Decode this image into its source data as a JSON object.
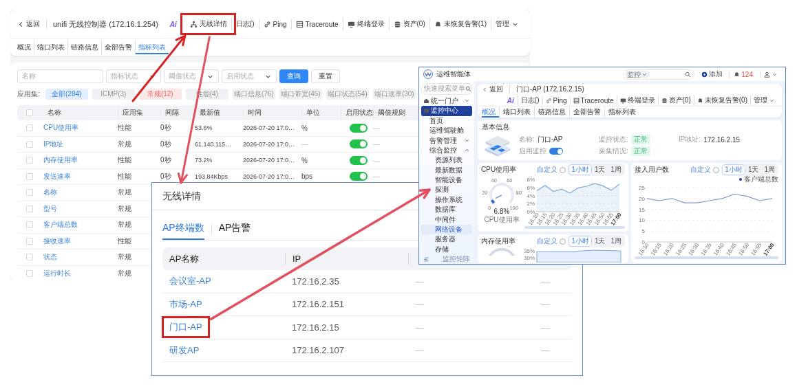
{
  "main_page": {
    "header": {
      "back": "返回",
      "title": "unifi 无线控制器 (172.16.1.254)",
      "ai_label": "Ai",
      "actions": [
        {
          "kind": "network",
          "label": "无线详情",
          "highlighted": true
        },
        {
          "kind": "plain",
          "label": "日志()",
          "highlighted": false
        },
        {
          "kind": "link",
          "label": "Ping",
          "highlighted": false
        },
        {
          "kind": "grid",
          "label": "Traceroute",
          "highlighted": false
        },
        {
          "kind": "monitor",
          "label": "终端登录",
          "highlighted": false
        },
        {
          "kind": "database",
          "label": "资产(0)",
          "highlighted": false
        },
        {
          "kind": "bell",
          "label": "未恢复告警(1)",
          "highlighted": false
        },
        {
          "kind": "menu",
          "label": "管理",
          "highlighted": false
        }
      ]
    },
    "tabs": [
      {
        "label": "概况",
        "selected": false
      },
      {
        "label": "端口列表",
        "selected": false
      },
      {
        "label": "链路信息",
        "selected": false
      },
      {
        "label": "全部告警",
        "selected": false
      },
      {
        "label": "指标列表",
        "selected": true
      }
    ],
    "filters": [
      {
        "kind": "text",
        "placeholder": "名称"
      },
      {
        "kind": "select",
        "placeholder": "指标状态"
      },
      {
        "kind": "select",
        "placeholder": "阈值状态"
      },
      {
        "kind": "select",
        "placeholder": "启用状态"
      }
    ],
    "buttons": [
      {
        "kind": "primary",
        "label": "查询"
      },
      {
        "kind": "default",
        "label": "重置"
      }
    ],
    "app_set_label": "应用集:",
    "app_sets": [
      {
        "label": "全部(284)",
        "selected": true,
        "hovered": false
      },
      {
        "label": "ICMP(3)",
        "selected": false,
        "hovered": false
      },
      {
        "label": "常规(12)",
        "selected": false,
        "hovered": true
      },
      {
        "label": "性能(4)",
        "selected": false,
        "hovered": false
      },
      {
        "label": "端口信息(76)",
        "selected": false,
        "hovered": false
      },
      {
        "label": "端口带宽(45)",
        "selected": false,
        "hovered": false
      },
      {
        "label": "端口状态(54)",
        "selected": false,
        "hovered": false
      },
      {
        "label": "端口速率(30)",
        "selected": false,
        "hovered": false
      }
    ],
    "table": {
      "select_all_checked": false,
      "columns": [
        "名称",
        "应用集",
        "间隔",
        "最新值",
        "时间",
        "单位",
        "启用状态",
        "阈值规则"
      ],
      "rows": [
        {
          "checked": false,
          "name": "CPU使用率",
          "app_set": "性能",
          "interval": "0秒",
          "latest": "53.6%",
          "time": "2026-07-20 17:0…",
          "unit": "%",
          "enabled": true,
          "threshold": "—"
        },
        {
          "checked": false,
          "name": "IP地址",
          "app_set": "常规",
          "interval": "0秒",
          "latest": "61.140.115…",
          "time": "2026-07-20 17:0…",
          "unit": "—",
          "enabled": true,
          "threshold": "—"
        },
        {
          "checked": false,
          "name": "内存使用率",
          "app_set": "性能",
          "interval": "0秒",
          "latest": "73.2%",
          "time": "2026-07-20 17:0…",
          "unit": "%",
          "enabled": true,
          "threshold": "—"
        },
        {
          "checked": false,
          "name": "发送速率",
          "app_set": "性能",
          "interval": "0秒",
          "latest": "193.84Kbps",
          "time": "2026-07-20 17:0…",
          "unit": "bps",
          "enabled": true,
          "threshold": "—"
        },
        {
          "checked": false,
          "name": "名称",
          "app_set": "常规"
        },
        {
          "checked": false,
          "name": "型号",
          "app_set": "常规"
        },
        {
          "checked": false,
          "name": "客户端总数",
          "app_set": "常规"
        },
        {
          "checked": false,
          "name": "接收速率",
          "app_set": "性能"
        },
        {
          "checked": false,
          "name": "状态",
          "app_set": "常规"
        },
        {
          "checked": false,
          "name": "运行时长",
          "app_set": "常规"
        }
      ]
    }
  },
  "wireless_dialog": {
    "title": "无线详情",
    "tabs": [
      {
        "label": "AP终端数",
        "selected": true
      },
      {
        "label": "AP告警",
        "selected": false
      }
    ],
    "columns": [
      "AP名称",
      "IP"
    ],
    "rows": [
      {
        "name": "会议室-AP",
        "ip": "172.16.2.35",
        "column_3": "—",
        "column_4": "—",
        "highlighted": false
      },
      {
        "name": "市场-AP",
        "ip": "172.16.2.151",
        "column_3": "—",
        "column_4": "—",
        "highlighted": false
      },
      {
        "name": "门口-AP",
        "ip": "172.16.2.15",
        "column_3": "—",
        "column_4": "—",
        "highlighted": true
      },
      {
        "name": "研发AP",
        "ip": "172.16.2.107",
        "column_3": "—",
        "column_4": "—",
        "highlighted": false
      }
    ]
  },
  "inset_screen": {
    "app_name": "运维智能体",
    "topbar": {
      "search_scope": "监控",
      "add": "添加",
      "alarm_count": "124"
    },
    "sidebar": {
      "search_placeholder": "快速搜索菜单",
      "items": [
        {
          "label": "统一门户",
          "kind": "home",
          "selected": false,
          "expanded": false
        },
        {
          "label": "监控中心",
          "kind": "monitor",
          "selected": true,
          "expanded": true,
          "children": [
            {
              "label": "首页",
              "selected": false
            },
            {
              "label": "运维驾驶舱",
              "selected": false
            },
            {
              "label": "告警管理",
              "selected": false,
              "expanded": false
            },
            {
              "label": "综合监控",
              "selected": false,
              "expanded": true,
              "children": [
                {
                  "label": "资源列表",
                  "selected": false
                },
                {
                  "label": "最新数据",
                  "selected": false
                },
                {
                  "label": "智能设备",
                  "selected": false
                },
                {
                  "label": "探测",
                  "selected": false
                },
                {
                  "label": "操作系统",
                  "selected": false
                },
                {
                  "label": "数据库",
                  "selected": false
                },
                {
                  "label": "中间件",
                  "selected": false
                },
                {
                  "label": "网络设备",
                  "selected": true
                },
                {
                  "label": "服务器",
                  "selected": false
                },
                {
                  "label": "存储",
                  "selected": false
                }
              ]
            }
          ]
        }
      ],
      "footer": "监控矩阵"
    },
    "header": {
      "back": "返回",
      "title": "门口-AP (172.16.2.15)",
      "ai_label": "Ai",
      "actions": [
        {
          "kind": "plain",
          "label": "日志()"
        },
        {
          "kind": "link",
          "label": "Ping"
        },
        {
          "kind": "grid",
          "label": "Traceroute"
        },
        {
          "kind": "monitor",
          "label": "终端登录"
        },
        {
          "kind": "database",
          "label": "资产(0)"
        },
        {
          "kind": "bell",
          "label": "未恢复告警(0)"
        },
        {
          "kind": "menu",
          "label": "管理"
        }
      ]
    },
    "tabs": [
      {
        "label": "概况",
        "selected": true
      },
      {
        "label": "端口列表",
        "selected": false
      },
      {
        "label": "链路信息",
        "selected": false
      },
      {
        "label": "全部告警",
        "selected": false
      },
      {
        "label": "指标列表",
        "selected": false
      }
    ],
    "basic_info": {
      "title": "基本信息",
      "fields": [
        {
          "kind": "text",
          "label": "名称:",
          "value": "门口-AP"
        },
        {
          "kind": "toggle",
          "label": "启用监控",
          "on": true
        },
        {
          "kind": "badge",
          "label": "监控状态:",
          "value": "正常"
        },
        {
          "kind": "badge",
          "label": "采集情况:",
          "value": "正常"
        },
        {
          "kind": "text",
          "label": "IP地址:",
          "value": "172.16.2.15"
        }
      ]
    },
    "cpu_card": {
      "title": "CPU使用率",
      "custom": "自定义",
      "ranges": [
        {
          "label": "1小时",
          "selected": true
        },
        {
          "label": "1天",
          "selected": false
        },
        {
          "label": "1周",
          "selected": false
        }
      ],
      "gauge": {
        "ticks": [
          "0",
          "20",
          "40",
          "60",
          "80",
          "100"
        ],
        "level": 0.068,
        "value": "6.8%",
        "label": "CPU使用率"
      },
      "zoom_slider": {
        "level": 1
      },
      "chart_data": {
        "type": "area",
        "grid": true,
        "categories": [
          "16:10",
          "16:15",
          "16:20",
          "16:25",
          "16:30",
          "16:35",
          "16:40",
          "16:45",
          "16:50",
          "16:55",
          "17:00"
        ],
        "ylim": [
          0,
          8
        ],
        "yticks": [
          {
            "value": 0,
            "label": "0%"
          },
          {
            "value": 2,
            "label": "2%"
          },
          {
            "value": 4,
            "label": "4%"
          },
          {
            "value": 6,
            "label": "6%"
          },
          {
            "value": 8,
            "label": "8%"
          }
        ],
        "series": [
          {
            "color": "#7aa7e0",
            "values": [
              5.2,
              6.5,
              5,
              5.6,
              4.6,
              5.9,
              6.3,
              7,
              6.4,
              5.3,
              6.8
            ]
          }
        ]
      }
    },
    "users_card": {
      "title": "接入用户数",
      "custom": "自定义",
      "ranges": [
        {
          "label": "1小时",
          "selected": true
        },
        {
          "label": "1天",
          "selected": false
        },
        {
          "label": "1周",
          "selected": false
        }
      ],
      "zoom_slider": {
        "level": 1
      },
      "chart_data": {
        "type": "line",
        "grid": true,
        "categories": [
          "16:10",
          "16:15",
          "16:20",
          "16:25",
          "16:30",
          "16:35",
          "16:40",
          "16:45",
          "16:50",
          "16:55",
          "17:00"
        ],
        "ylim": [
          0,
          25
        ],
        "yticks": [
          0,
          5,
          10,
          15,
          20,
          25
        ],
        "series": [
          {
            "name": "客户端总数",
            "color": "#7d97cc",
            "values": [
              20,
              19,
              20,
              18,
              18,
              19,
              20,
              22,
              21,
              19,
              20
            ]
          }
        ]
      }
    },
    "memory_card": {
      "title": "内存使用率",
      "custom": "自定义",
      "ranges": [
        {
          "label": "1小时",
          "selected": true
        },
        {
          "label": "1天",
          "selected": false
        },
        {
          "label": "1周",
          "selected": false
        }
      ],
      "tick_labels": [
        "35%",
        "30%"
      ]
    }
  }
}
